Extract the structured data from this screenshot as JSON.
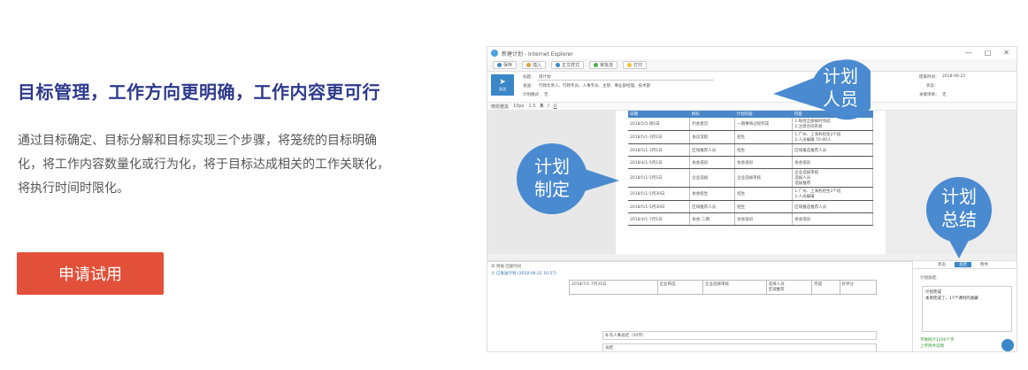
{
  "marketing": {
    "headline": "目标管理，工作方向更明确，工作内容更可行",
    "description": "通过目标确定、目标分解和目标实现三个步骤，将笼统的目标明确化，将工作内容数量化或行为化，将于目标达成相关的工作关联化，将执行时间时限化。",
    "cta_label": "申请试用"
  },
  "app": {
    "window_title": "新建计划 - Internet Explorer",
    "win_controls": [
      "—",
      "□",
      "✕"
    ],
    "toolbar": [
      "保存",
      "插入",
      "正文样式",
      "审批流",
      "打印"
    ],
    "send_label": "发送",
    "form": {
      "title_label": "标题：",
      "title_value": "周计划",
      "recipients_label": "发送：",
      "recipients_value": "行政负责人、行政专员、人事专员、主管、事业部经理、技术部",
      "plan_type_label": "计划模式：",
      "plan_type_value": "无",
      "end_date_label": "结束时间：",
      "end_date_value": "2018-06-22",
      "status_label": "状态：",
      "related_label": "关联项目：",
      "related_value": "无"
    },
    "format_bar": [
      "微软雅黑",
      "10px",
      "1.5",
      "B",
      "I",
      "U"
    ],
    "table": {
      "headers": [
        "日期",
        "目标",
        "计划内容",
        "内容"
      ],
      "rows": [
        [
          "2018/5/5-周6日",
          "约会意见",
          "一期事情过程完成",
          "1.每周全部按时完成\n2.注意合同条款"
        ],
        [
          "2018/5/1-3月1日",
          "协议流程",
          "招生",
          "1.广州、上海各招生2个班\n2.人员编辑 70-80人"
        ],
        [
          "2018/5/1-3月1日",
          "区域推荐人员",
          "招生",
          "区域推选推荐人员"
        ],
        [
          "2018/4/1-5月1日",
          "协会培训",
          "协会培训",
          "协会培训"
        ],
        [
          "2018/5/1-5月1日",
          "企业选拔",
          "企业选拔审核",
          "企业选拔审核\n选拔人员\n选拔推荐"
        ],
        [
          "2018/5/1-5月30日",
          "协会招生",
          "招生",
          "1.广州、上海各招生2个班\n2.人员编辑"
        ],
        [
          "2018/5/1-5月30日",
          "区域推荐人员",
          "招生",
          "区域推选推荐人员"
        ],
        [
          "2018/4/1-7月1日",
          "协会-二期",
          "协会培训",
          "协会培训"
        ]
      ]
    },
    "bottom": {
      "header": "日 周报 回复时间",
      "sub_header": "人 已发送计划 (2018-06-22 10:57)",
      "row": [
        "2018/7/1-7月31日",
        "企业筛选",
        "企业选择审核",
        "选择人员\n区域推荐",
        "完成",
        "好评分"
      ],
      "summary_placeholder": "补充人事总结（50字）",
      "summary2": "总结"
    },
    "side_panel": {
      "tabs": [
        "状态",
        "总结",
        "附件"
      ],
      "active_tab": "总结",
      "label": "计划总结：",
      "text": "计划完成\n本周完成了，17个课时的收藏",
      "green_text": "字数统计1200个字\n上传附件说明"
    }
  },
  "callouts": [
    {
      "line1": "计划",
      "line2": "人员"
    },
    {
      "line1": "计划",
      "line2": "制定"
    },
    {
      "line1": "计划",
      "line2": "总结"
    }
  ],
  "colors": {
    "headline": "#2d3a8c",
    "cta": "#e2503a",
    "bubble": "#4a8ad0",
    "app_accent": "#3a87c8"
  }
}
